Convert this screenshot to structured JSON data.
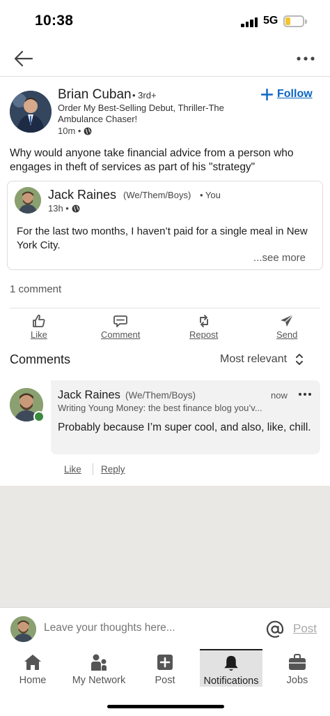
{
  "status_bar": {
    "time": "10:38",
    "network": "5G",
    "battery_level": 0.3,
    "battery_color": "#f4c430"
  },
  "nav": {
    "back_icon": "arrow-left-icon",
    "more_icon": "ellipsis-icon"
  },
  "post": {
    "author": {
      "name": "Brian Cuban",
      "degree": "• 3rd+",
      "headline": "Order My Best-Selling Debut, Thriller-The Ambulance Chaser!",
      "time": "10m •"
    },
    "follow_label": "Follow",
    "text": "Why would anyone take financial advice from a person who engages in theft of services as part of his \"strategy\"",
    "reshare": {
      "name": "Jack Raines",
      "pronouns": "(We/Them/Boys)",
      "you": "• You",
      "time": "13h •",
      "text": "For the last two months, I haven’t paid for a single meal in New York City.",
      "see_more": "...see more"
    },
    "comment_count": "1 comment"
  },
  "actions": [
    {
      "label": "Like",
      "icon": "thumbs-up-icon"
    },
    {
      "label": "Comment",
      "icon": "comment-icon"
    },
    {
      "label": "Repost",
      "icon": "repost-icon"
    },
    {
      "label": "Send",
      "icon": "send-icon"
    }
  ],
  "comments_section": {
    "title": "Comments",
    "sort_label": "Most relevant",
    "comments": [
      {
        "name": "Jack Raines",
        "pronouns": "(We/Them/Boys)",
        "time": "now",
        "headline": "Writing Young Money: the best finance blog you’v...",
        "text": "Probably because I’m super cool, and also, like, chill.",
        "like_label": "Like",
        "reply_label": "Reply"
      }
    ]
  },
  "composer": {
    "placeholder": "Leave your thoughts here...",
    "post_label": "Post"
  },
  "tabs": [
    {
      "label": "Home",
      "icon": "home-icon"
    },
    {
      "label": "My Network",
      "icon": "network-icon"
    },
    {
      "label": "Post",
      "icon": "plus-square-icon"
    },
    {
      "label": "Notifications",
      "icon": "bell-icon",
      "active": true
    },
    {
      "label": "Jobs",
      "icon": "briefcase-icon"
    }
  ],
  "colors": {
    "accent": "#0a66c2",
    "online": "#3c8a3f",
    "icon_gray": "#555555"
  }
}
